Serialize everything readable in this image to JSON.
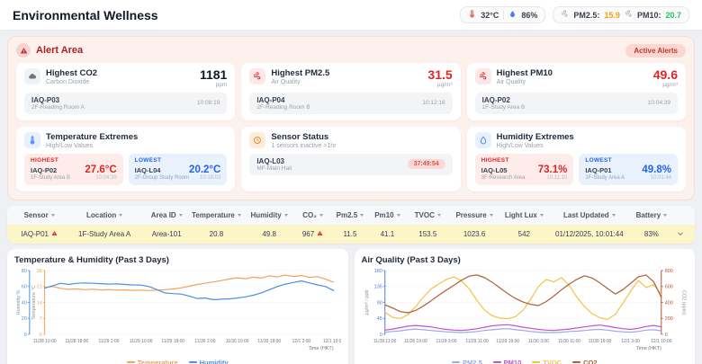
{
  "header": {
    "title": "Environmental Wellness",
    "temp": "32°C",
    "humidity": "86%",
    "pm25_label": "PM2.5:",
    "pm25_value": "15.9",
    "pm10_label": "PM10:",
    "pm10_value": "20.7"
  },
  "alert": {
    "title": "Alert Area",
    "badge": "Active Alerts",
    "cards": {
      "co2": {
        "title": "Highest CO2",
        "subtitle": "Carbon Dioxide",
        "value": "1181",
        "unit": "ppm",
        "sensor": "IAQ-P03",
        "location": "2F-Reading Room A",
        "time": "10:08:19"
      },
      "pm25": {
        "title": "Highest PM2.5",
        "subtitle": "Air Quality",
        "value": "31.5",
        "unit": "µg/m³",
        "sensor": "IAQ-P04",
        "location": "2F-Reading Room B",
        "time": "10:12:16"
      },
      "pm10": {
        "title": "Highest PM10",
        "subtitle": "Air Quality",
        "value": "49.6",
        "unit": "µg/m³",
        "sensor": "IAQ-P02",
        "location": "1F-Study Area B",
        "time": "10:04:39"
      },
      "temperature": {
        "title": "Temperature Extremes",
        "subtitle": "High/Low Values",
        "highest": {
          "label": "HIGHEST",
          "sensor": "IAQ-P02",
          "value": "27.6°C",
          "location": "1F-Study Area B",
          "time": "10:04:39"
        },
        "lowest": {
          "label": "LOWEST",
          "sensor": "IAQ-L04",
          "value": "20.2°C",
          "location": "2F-Group Study Room",
          "time": "10:18:03"
        }
      },
      "status": {
        "title": "Sensor Status",
        "subtitle": "1 sensors inactive >1hr",
        "sensor": "IAQ-L03",
        "location": "MF-Main Hall",
        "badge": "37:49:54"
      },
      "humidity": {
        "title": "Humidity Extremes",
        "subtitle": "High/Low Values",
        "highest": {
          "label": "HIGHEST",
          "sensor": "IAQ-L05",
          "value": "73.1%",
          "location": "3F-Research Area",
          "time": "10:11:10"
        },
        "lowest": {
          "label": "LOWEST",
          "sensor": "IAQ-P01",
          "value": "49.8%",
          "location": "1F-Study Area A",
          "time": "10:01:44"
        }
      }
    }
  },
  "table": {
    "headers": [
      "Sensor",
      "Location",
      "Area ID",
      "Temperature",
      "Humidity",
      "CO₂",
      "Pm2.5",
      "Pm10",
      "TVOC",
      "Pressure",
      "Light Lux",
      "Last Updated",
      "Battery"
    ],
    "rows": [
      {
        "cells": [
          {
            "text": "IAQ-P01",
            "warn": true
          },
          {
            "text": "1F-Study Area A"
          },
          {
            "text": "Area-101"
          },
          {
            "text": "20.8"
          },
          {
            "text": "49.8"
          },
          {
            "text": "967",
            "warn": true
          },
          {
            "text": "11.5"
          },
          {
            "text": "41.1"
          },
          {
            "text": "153.5"
          },
          {
            "text": "1023.6"
          },
          {
            "text": "542"
          },
          {
            "text": "01/12/2025, 10:01:44"
          },
          {
            "text": "83%"
          }
        ]
      }
    ]
  },
  "chart_data": [
    {
      "type": "line",
      "title": "Temperature & Humidity (Past 3 Days)",
      "xlabel": "Time (HKT)",
      "grid": true,
      "legend_position": "bottom",
      "x_ticks": [
        "11/28 10:00",
        "11/28 18:00",
        "11/29 2:00",
        "11/29 10:00",
        "11/29 18:00",
        "11/30 2:00",
        "11/30 10:00",
        "11/30 18:00",
        "12/1 2:00",
        "12/1 10:00"
      ],
      "axes": [
        {
          "id": "humidity",
          "label": "Humidity %",
          "color": "#4a90e2",
          "min": 0,
          "max": 80,
          "ticks": [
            0,
            20,
            40,
            60,
            80
          ],
          "position": "left-outer"
        },
        {
          "id": "temperature",
          "label": "Temperature °C",
          "color": "#f2a25c",
          "min": 0,
          "max": 28,
          "ticks": [
            0,
            7,
            14,
            21,
            28
          ],
          "position": "left-inner"
        }
      ],
      "series": [
        {
          "name": "Temperature",
          "color": "#f2a25c",
          "axis": "temperature",
          "values": [
            20.6,
            21.0,
            20.2,
            19.7,
            19.9,
            19.6,
            19.8,
            19.5,
            19.6,
            19.4,
            19.5,
            19.3,
            19.4,
            19.2,
            19.4,
            19.6,
            19.9,
            20.4,
            21.1,
            21.9,
            22.4,
            23.0,
            23.6,
            24.3,
            24.8,
            24.4,
            25.1,
            24.7,
            25.7,
            25.2,
            26.0,
            25.4,
            25.8,
            25.0,
            25.3,
            24.2,
            22.9
          ]
        },
        {
          "name": "Humidity",
          "color": "#4a90e2",
          "axis": "humidity",
          "values": [
            58,
            61,
            64,
            62.5,
            64,
            64.5,
            64,
            63.5,
            63,
            63.2,
            62.5,
            62,
            61.8,
            60,
            56,
            52,
            51,
            50.5,
            48,
            45,
            45.5,
            43.5,
            44,
            44.5,
            45.5,
            47,
            49,
            52,
            56,
            60,
            63,
            65,
            67,
            64.5,
            62,
            60,
            55
          ]
        }
      ]
    },
    {
      "type": "line",
      "title": "Air Quality (Past 3 Days)",
      "xlabel": "Time (HKT)",
      "grid": true,
      "legend_position": "bottom",
      "x_ticks": [
        "11/28 11:00",
        "11/28 19:00",
        "11/29 3:00",
        "11/29 11:00",
        "11/29 19:00",
        "11/30 3:00",
        "11/30 11:00",
        "11/30 19:00",
        "12/1 3:00",
        "12/1 10:00"
      ],
      "axes": [
        {
          "id": "pollutant",
          "label": "µg/m³ / ppb",
          "color": "#4a7de0",
          "min": 0,
          "max": 180,
          "ticks": [
            0,
            45,
            90,
            135,
            180
          ],
          "position": "left"
        },
        {
          "id": "co2",
          "label": "CO2 (ppm)",
          "color": "#b0552f",
          "min": 0,
          "max": 800,
          "ticks": [
            0,
            200,
            400,
            600,
            800
          ],
          "position": "right"
        }
      ],
      "series": [
        {
          "name": "PM2.5",
          "color": "#9aa8ec",
          "axis": "pollutant",
          "values": [
            6,
            8,
            10,
            13,
            15,
            13,
            11,
            9,
            7,
            6,
            5,
            6,
            8,
            11,
            13,
            15,
            16,
            13,
            11,
            8,
            6,
            5,
            5,
            6,
            8,
            9,
            11,
            13,
            14,
            12,
            9,
            7,
            6,
            8,
            12,
            13,
            10
          ]
        },
        {
          "name": "PM10",
          "color": "#c44fd0",
          "axis": "pollutant",
          "values": [
            12,
            15,
            19,
            23,
            25,
            23,
            21,
            17,
            14,
            12,
            11,
            13,
            16,
            20,
            24,
            26,
            27,
            24,
            20,
            17,
            14,
            12,
            11,
            13,
            15,
            18,
            21,
            24,
            26,
            23,
            19,
            16,
            14,
            17,
            22,
            25,
            21
          ]
        },
        {
          "name": "TVOC",
          "color": "#f6c244",
          "axis": "pollutant",
          "values": [
            62,
            48,
            45,
            55,
            78,
            105,
            128,
            142,
            155,
            162,
            150,
            128,
            95,
            68,
            52,
            46,
            44,
            50,
            68,
            100,
            135,
            155,
            148,
            160,
            138,
            105,
            78,
            58,
            47,
            42,
            56,
            88,
            122,
            152,
            132,
            140,
            113
          ]
        },
        {
          "name": "CO2",
          "color": "#b05c35",
          "axis": "co2",
          "values": [
            370,
            330,
            285,
            270,
            300,
            355,
            420,
            490,
            555,
            615,
            680,
            730,
            745,
            710,
            650,
            580,
            510,
            450,
            405,
            375,
            360,
            410,
            480,
            560,
            630,
            690,
            735,
            705,
            645,
            575,
            505,
            560,
            640,
            720,
            745,
            660,
            465
          ]
        }
      ]
    }
  ]
}
